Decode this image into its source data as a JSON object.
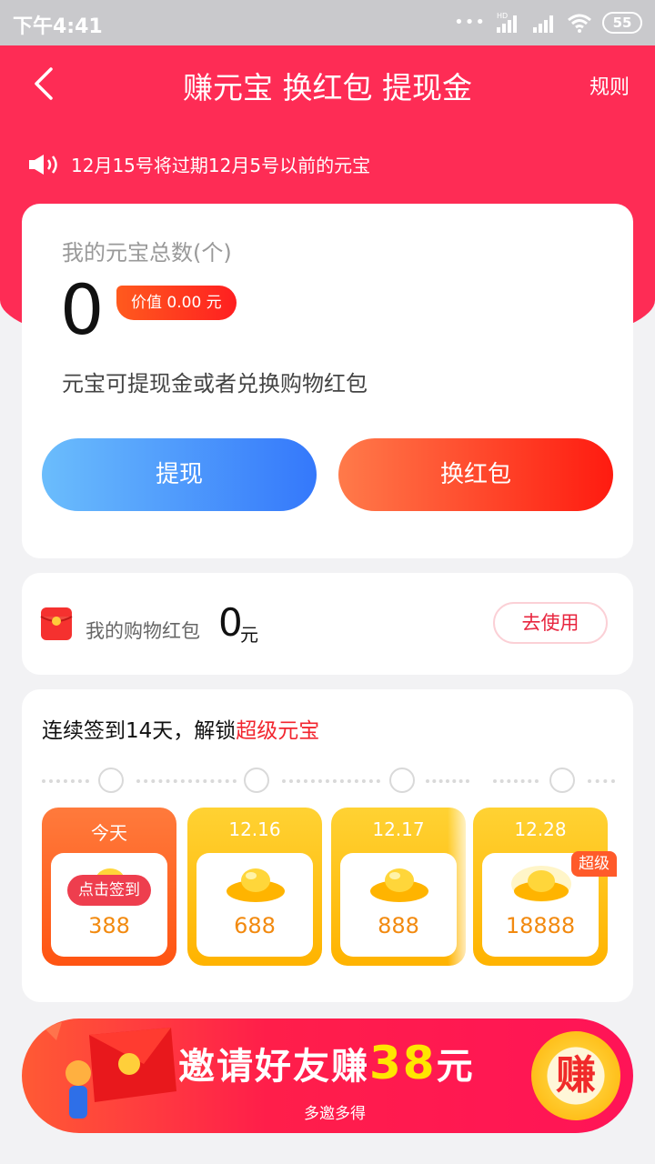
{
  "status_bar": {
    "time": "下午4:41",
    "battery": "55",
    "signal_badge": "HD"
  },
  "nav": {
    "title": "赚元宝 换红包 提现金",
    "rules_label": "规则"
  },
  "notice": {
    "text": "12月15号将过期12月5号以前的元宝"
  },
  "balance": {
    "label": "我的元宝总数(个)",
    "count": "0",
    "value_badge": "价值 0.00 元",
    "description": "元宝可提现金或者兑换购物红包",
    "withdraw_label": "提现",
    "exchange_label": "换红包"
  },
  "red_packet": {
    "label": "我的购物红包",
    "amount": "0",
    "unit": "元",
    "use_label": "去使用"
  },
  "signin": {
    "title_prefix": "连续签到14天，解锁",
    "title_highlight": "超级元宝",
    "days": [
      {
        "label": "今天",
        "amount": "388",
        "action": "点击签到"
      },
      {
        "label": "12.16",
        "amount": "688"
      },
      {
        "label": "12.17",
        "amount": "888"
      },
      {
        "label": "12.28",
        "amount": "18888",
        "badge": "超级"
      }
    ]
  },
  "invite": {
    "title_prefix": "邀请好友赚",
    "amount": "38",
    "unit": "元",
    "subtitle": "多邀多得",
    "coin_label": "赚"
  },
  "colors": {
    "brand_red": "#fe2c55",
    "withdraw_blue": "#3478fb",
    "exchange_red": "#ff1b10",
    "coin_gold": "#ffb300"
  },
  "icons": [
    "back-icon",
    "speaker-icon",
    "red-packet-icon",
    "ingot-icon",
    "wifi-icon",
    "signal-icon"
  ]
}
